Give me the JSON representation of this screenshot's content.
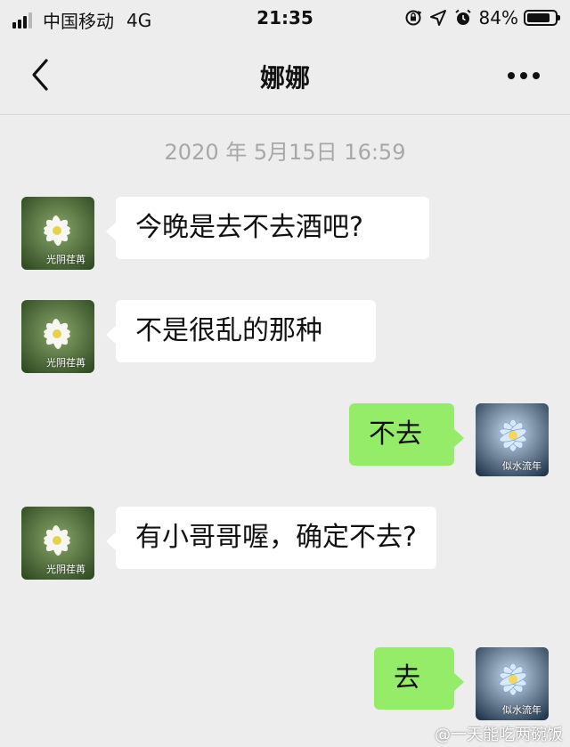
{
  "status_bar": {
    "carrier": "中国移动",
    "network": "4G",
    "time": "21:35",
    "battery_percent": "84%",
    "battery_level": 0.84,
    "icons": [
      "rotation-lock-icon",
      "location-icon",
      "alarm-icon",
      "battery-icon"
    ]
  },
  "nav": {
    "title": "娜娜",
    "back_icon": "chevron-left-icon",
    "more_icon": "more-dots-icon"
  },
  "chat": {
    "timestamp": "2020 年 5月15日 16:59",
    "messages": [
      {
        "side": "in",
        "text": "今晚是去不去酒吧?",
        "avatar_caption": "光阴荏苒"
      },
      {
        "side": "in",
        "text": "不是很乱的那种",
        "avatar_caption": "光阴荏苒"
      },
      {
        "side": "out",
        "text": "不去",
        "avatar_caption": "似水流年"
      },
      {
        "side": "in",
        "text": "有小哥哥喔，确定不去?",
        "avatar_caption": "光阴荏苒"
      },
      {
        "side": "out",
        "text": "去",
        "avatar_caption": "似水流年"
      }
    ]
  },
  "watermark": "@一天能吃两碗饭",
  "colors": {
    "background": "#ededed",
    "incoming_bubble": "#ffffff",
    "outgoing_bubble": "#95ec69",
    "timestamp_text": "#a8a8a8"
  }
}
